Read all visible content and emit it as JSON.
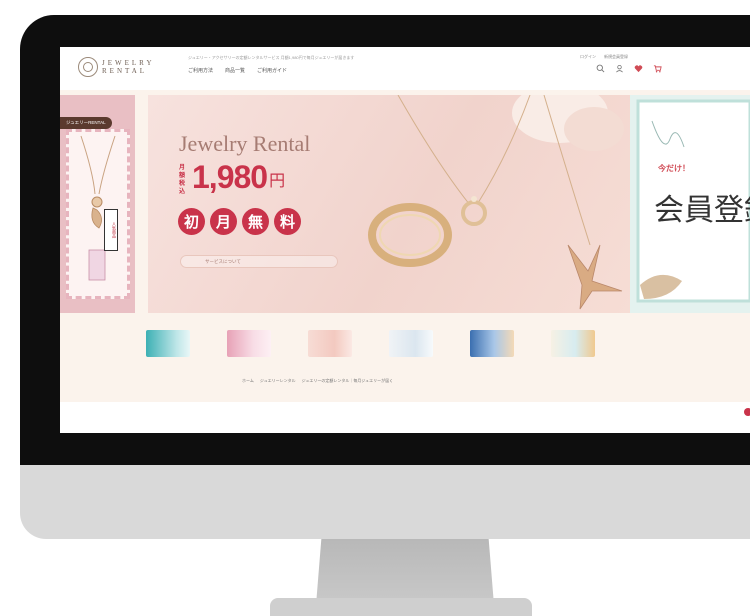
{
  "site": {
    "logo_line1": "JEWELRY",
    "logo_line2": "RENTAL",
    "top_notice": "ジュエリー・アクセサリーの定額レンタルサービス 月額1,980円で毎月ジュエリーが届きます",
    "nav": [
      "ご利用方法",
      "商品一覧",
      "ご利用ガイド"
    ],
    "account_links": [
      "ログイン",
      "新規会員登録"
    ]
  },
  "hero": {
    "left_badge": "ジュエリーRENTAL",
    "left_caption": "人気商品",
    "title": "Jewelry Rental",
    "price_tax_label": "月額税込",
    "price_value": "1,980",
    "price_unit": "円",
    "free_badges": [
      "初",
      "月",
      "無",
      "料"
    ],
    "service_link": "サービスについて",
    "right_promo_tag": "今だけ！",
    "right_promo_title": "会員登録"
  },
  "breadcrumb": [
    "ホーム",
    "ジュエリーレンタル",
    "ジュエリーの定額レンタル｜毎月ジュエリーが届く"
  ],
  "colors": {
    "accent": "#c9334a",
    "brown": "#5b3a2e",
    "banner": "#f1d3cc",
    "mint": "#e4f2ef"
  },
  "icons": [
    "search-icon",
    "user-icon",
    "heart-icon",
    "cart-icon"
  ]
}
